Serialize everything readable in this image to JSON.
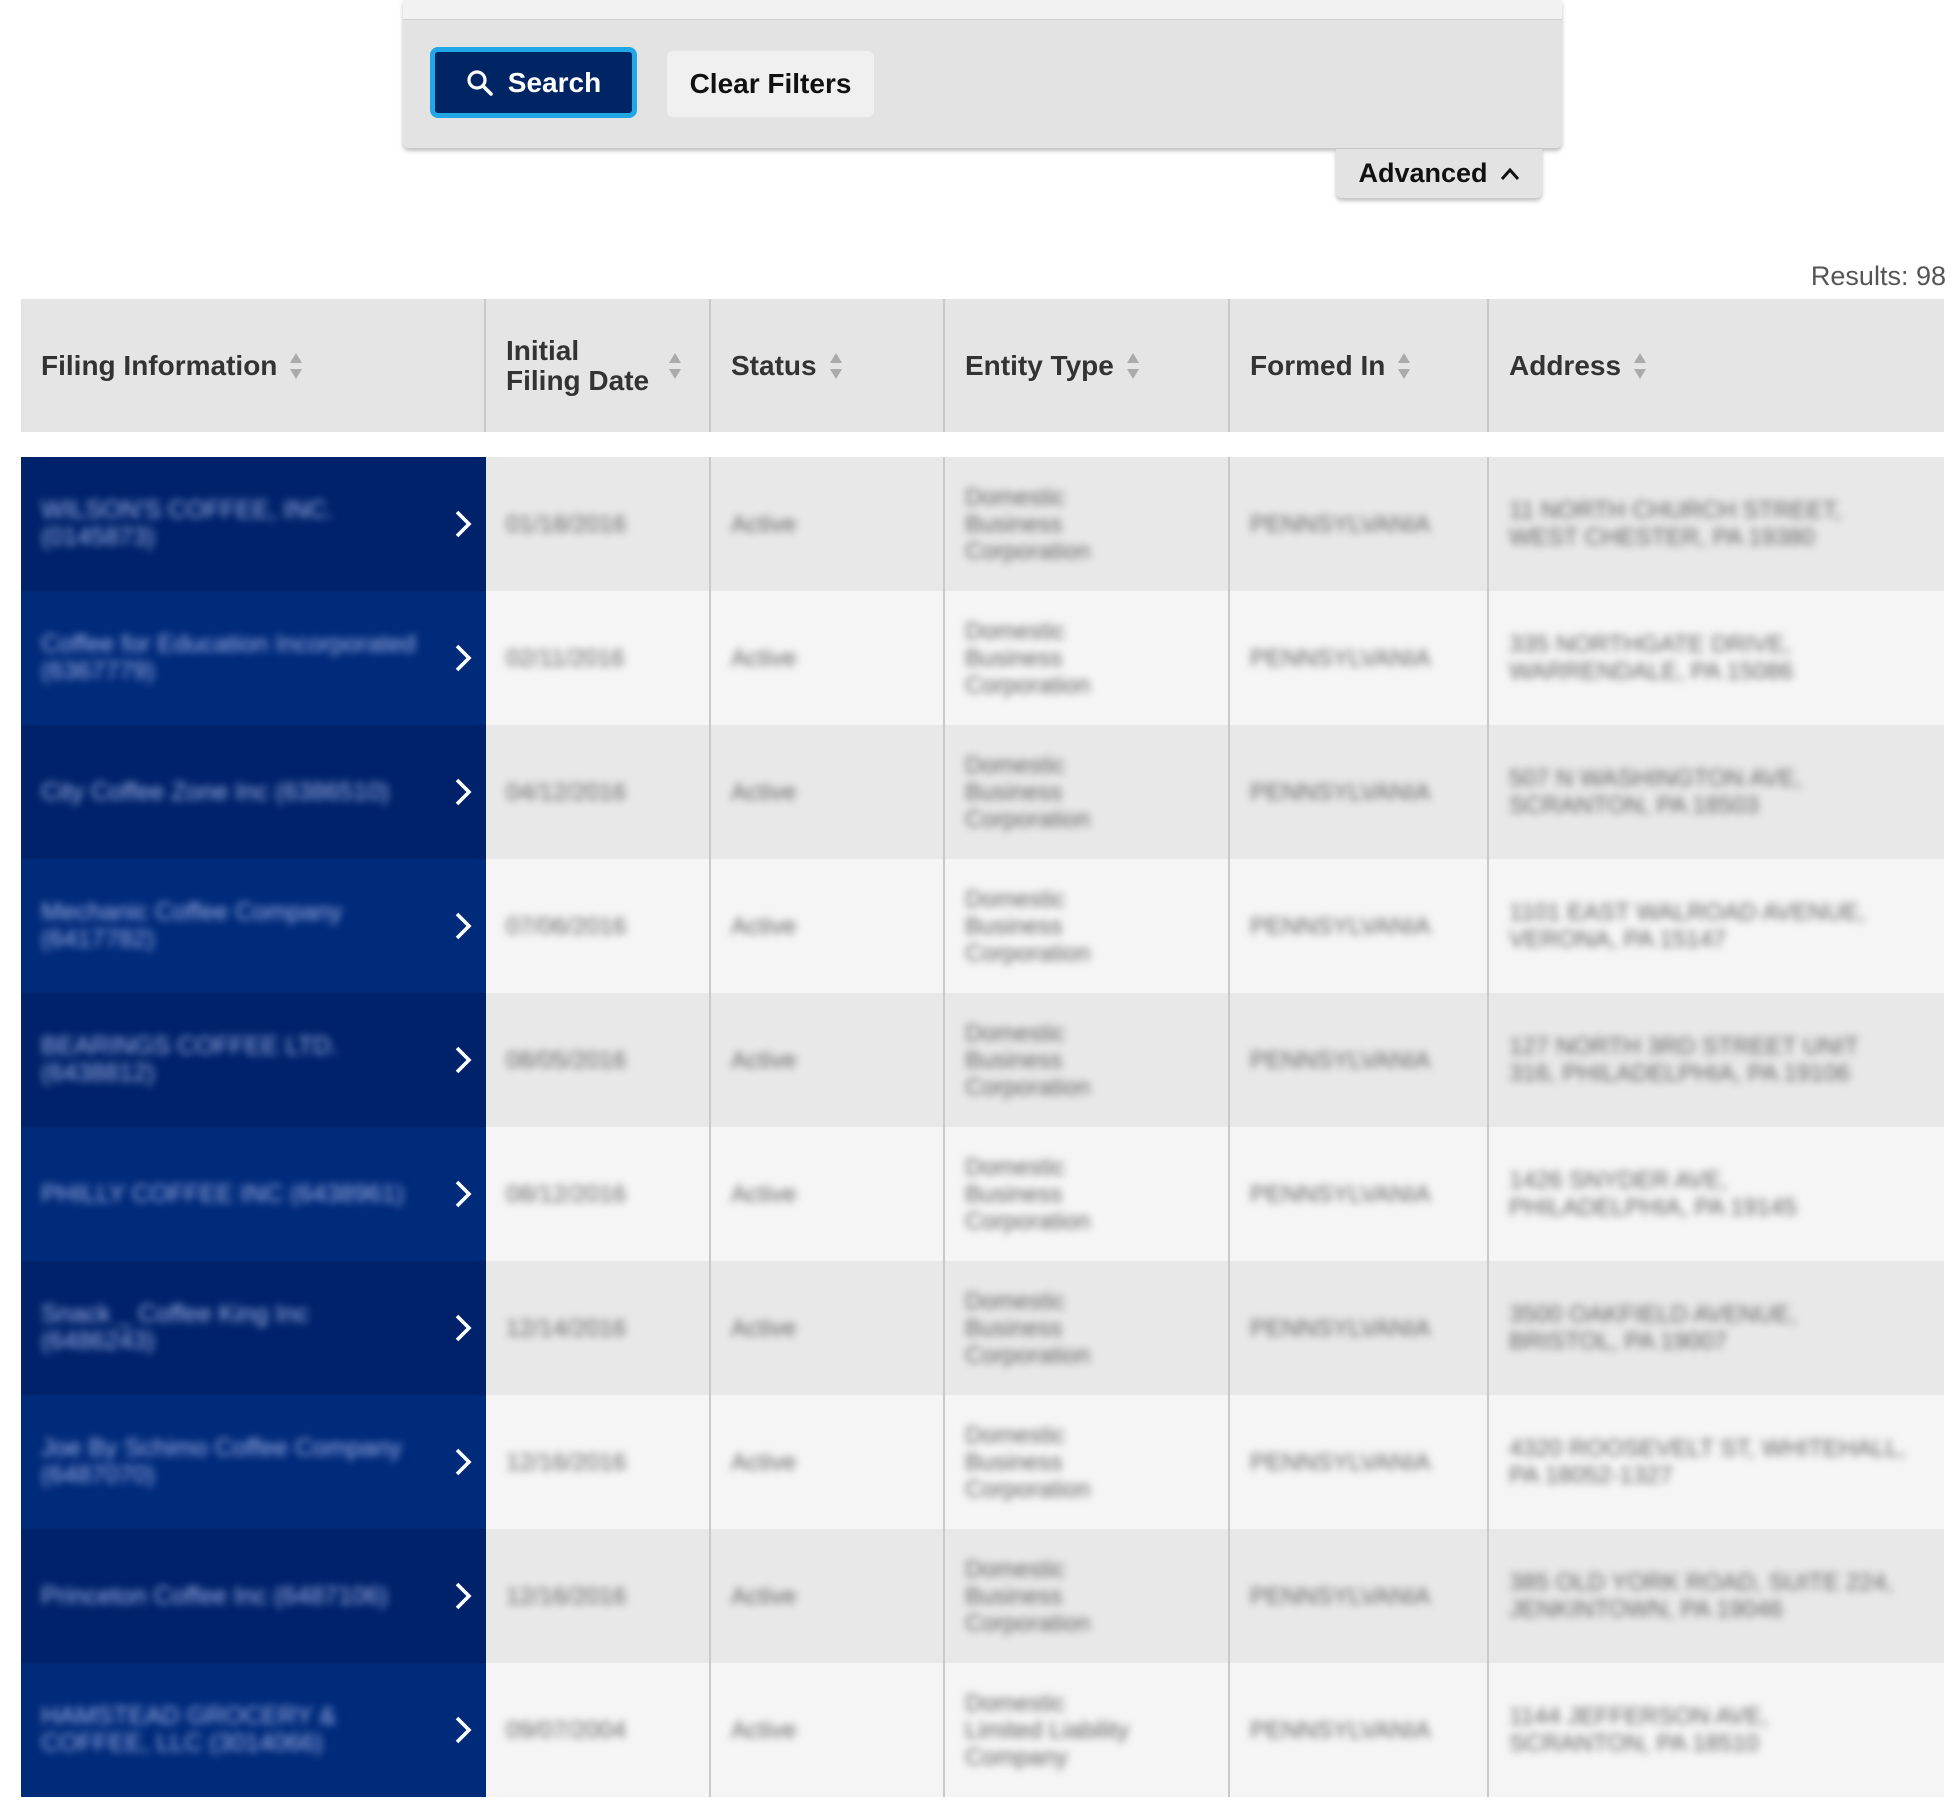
{
  "search": {
    "search_label": "Search",
    "clear_label": "Clear Filters",
    "advanced_label": "Advanced"
  },
  "results_label": "Results: 98",
  "table": {
    "headers": [
      "Filing Information",
      "Initial Filing Date",
      "Status",
      "Entity Type",
      "Formed In",
      "Address"
    ],
    "rows": [
      {
        "name": "WILSON'S COFFEE, INC. (0145873)",
        "date": "01/18/2016",
        "status": "Active",
        "type": "Domestic Business Corporation",
        "formed": "PENNSYLVANIA",
        "address": "11 NORTH CHURCH STREET, WEST CHESTER, PA 19380"
      },
      {
        "name": "Coffee for Education Incorporated (6367779)",
        "date": "02/11/2016",
        "status": "Active",
        "type": "Domestic Business Corporation",
        "formed": "PENNSYLVANIA",
        "address": "335 NORTHGATE DRIVE, WARRENDALE, PA 15086"
      },
      {
        "name": "City Coffee Zone Inc (6386510)",
        "date": "04/12/2016",
        "status": "Active",
        "type": "Domestic Business Corporation",
        "formed": "PENNSYLVANIA",
        "address": "507 N WASHINGTON AVE, SCRANTON, PA 18503"
      },
      {
        "name": "Mechanic Coffee Company (6417782)",
        "date": "07/06/2016",
        "status": "Active",
        "type": "Domestic Business Corporation",
        "formed": "PENNSYLVANIA",
        "address": "1101 EAST WALROAD AVENUE, VERONA, PA 15147"
      },
      {
        "name": "BEARINGS COFFEE LTD. (6438812)",
        "date": "08/05/2016",
        "status": "Active",
        "type": "Domestic Business Corporation",
        "formed": "PENNSYLVANIA",
        "address": "127 NORTH 3RD STREET UNIT 316, PHILADELPHIA, PA 19106"
      },
      {
        "name": "PHILLY COFFEE INC (6438961)",
        "date": "08/12/2016",
        "status": "Active",
        "type": "Domestic Business Corporation",
        "formed": "PENNSYLVANIA",
        "address": "1426 SNYDER AVE, PHILADELPHIA, PA 19145"
      },
      {
        "name": "Snack _ Coffee King Inc (6486243)",
        "date": "12/14/2016",
        "status": "Active",
        "type": "Domestic Business Corporation",
        "formed": "PENNSYLVANIA",
        "address": "3500 OAKFIELD AVENUE, BRISTOL, PA 19007"
      },
      {
        "name": "Joe By Schimo Coffee Company (6487070)",
        "date": "12/16/2016",
        "status": "Active",
        "type": "Domestic Business Corporation",
        "formed": "PENNSYLVANIA",
        "address": "4320 ROOSEVELT ST, WHITEHALL, PA 18052-1327"
      },
      {
        "name": "Princeton Coffee Inc (6487106)",
        "date": "12/16/2016",
        "status": "Active",
        "type": "Domestic Business Corporation",
        "formed": "PENNSYLVANIA",
        "address": "385 OLD YORK ROAD, SUITE 224, JENKINTOWN, PA 19046"
      },
      {
        "name": "HAMSTEAD GROCERY & COFFEE, LLC (3014066)",
        "date": "09/07/2004",
        "status": "Active",
        "type": "Domestic Limited Liability Company",
        "formed": "PENNSYLVANIA",
        "address": "1144 JEFFERSON AVE, SCRANTON, PA 18510"
      }
    ]
  },
  "colors": {
    "primary_navy": "#002565",
    "focus_ring": "#21a6e6",
    "row_link_bg": "#002a7a"
  },
  "icons": [
    "search-icon",
    "chevron-up-icon",
    "sort-icon",
    "chevron-right-icon"
  ]
}
